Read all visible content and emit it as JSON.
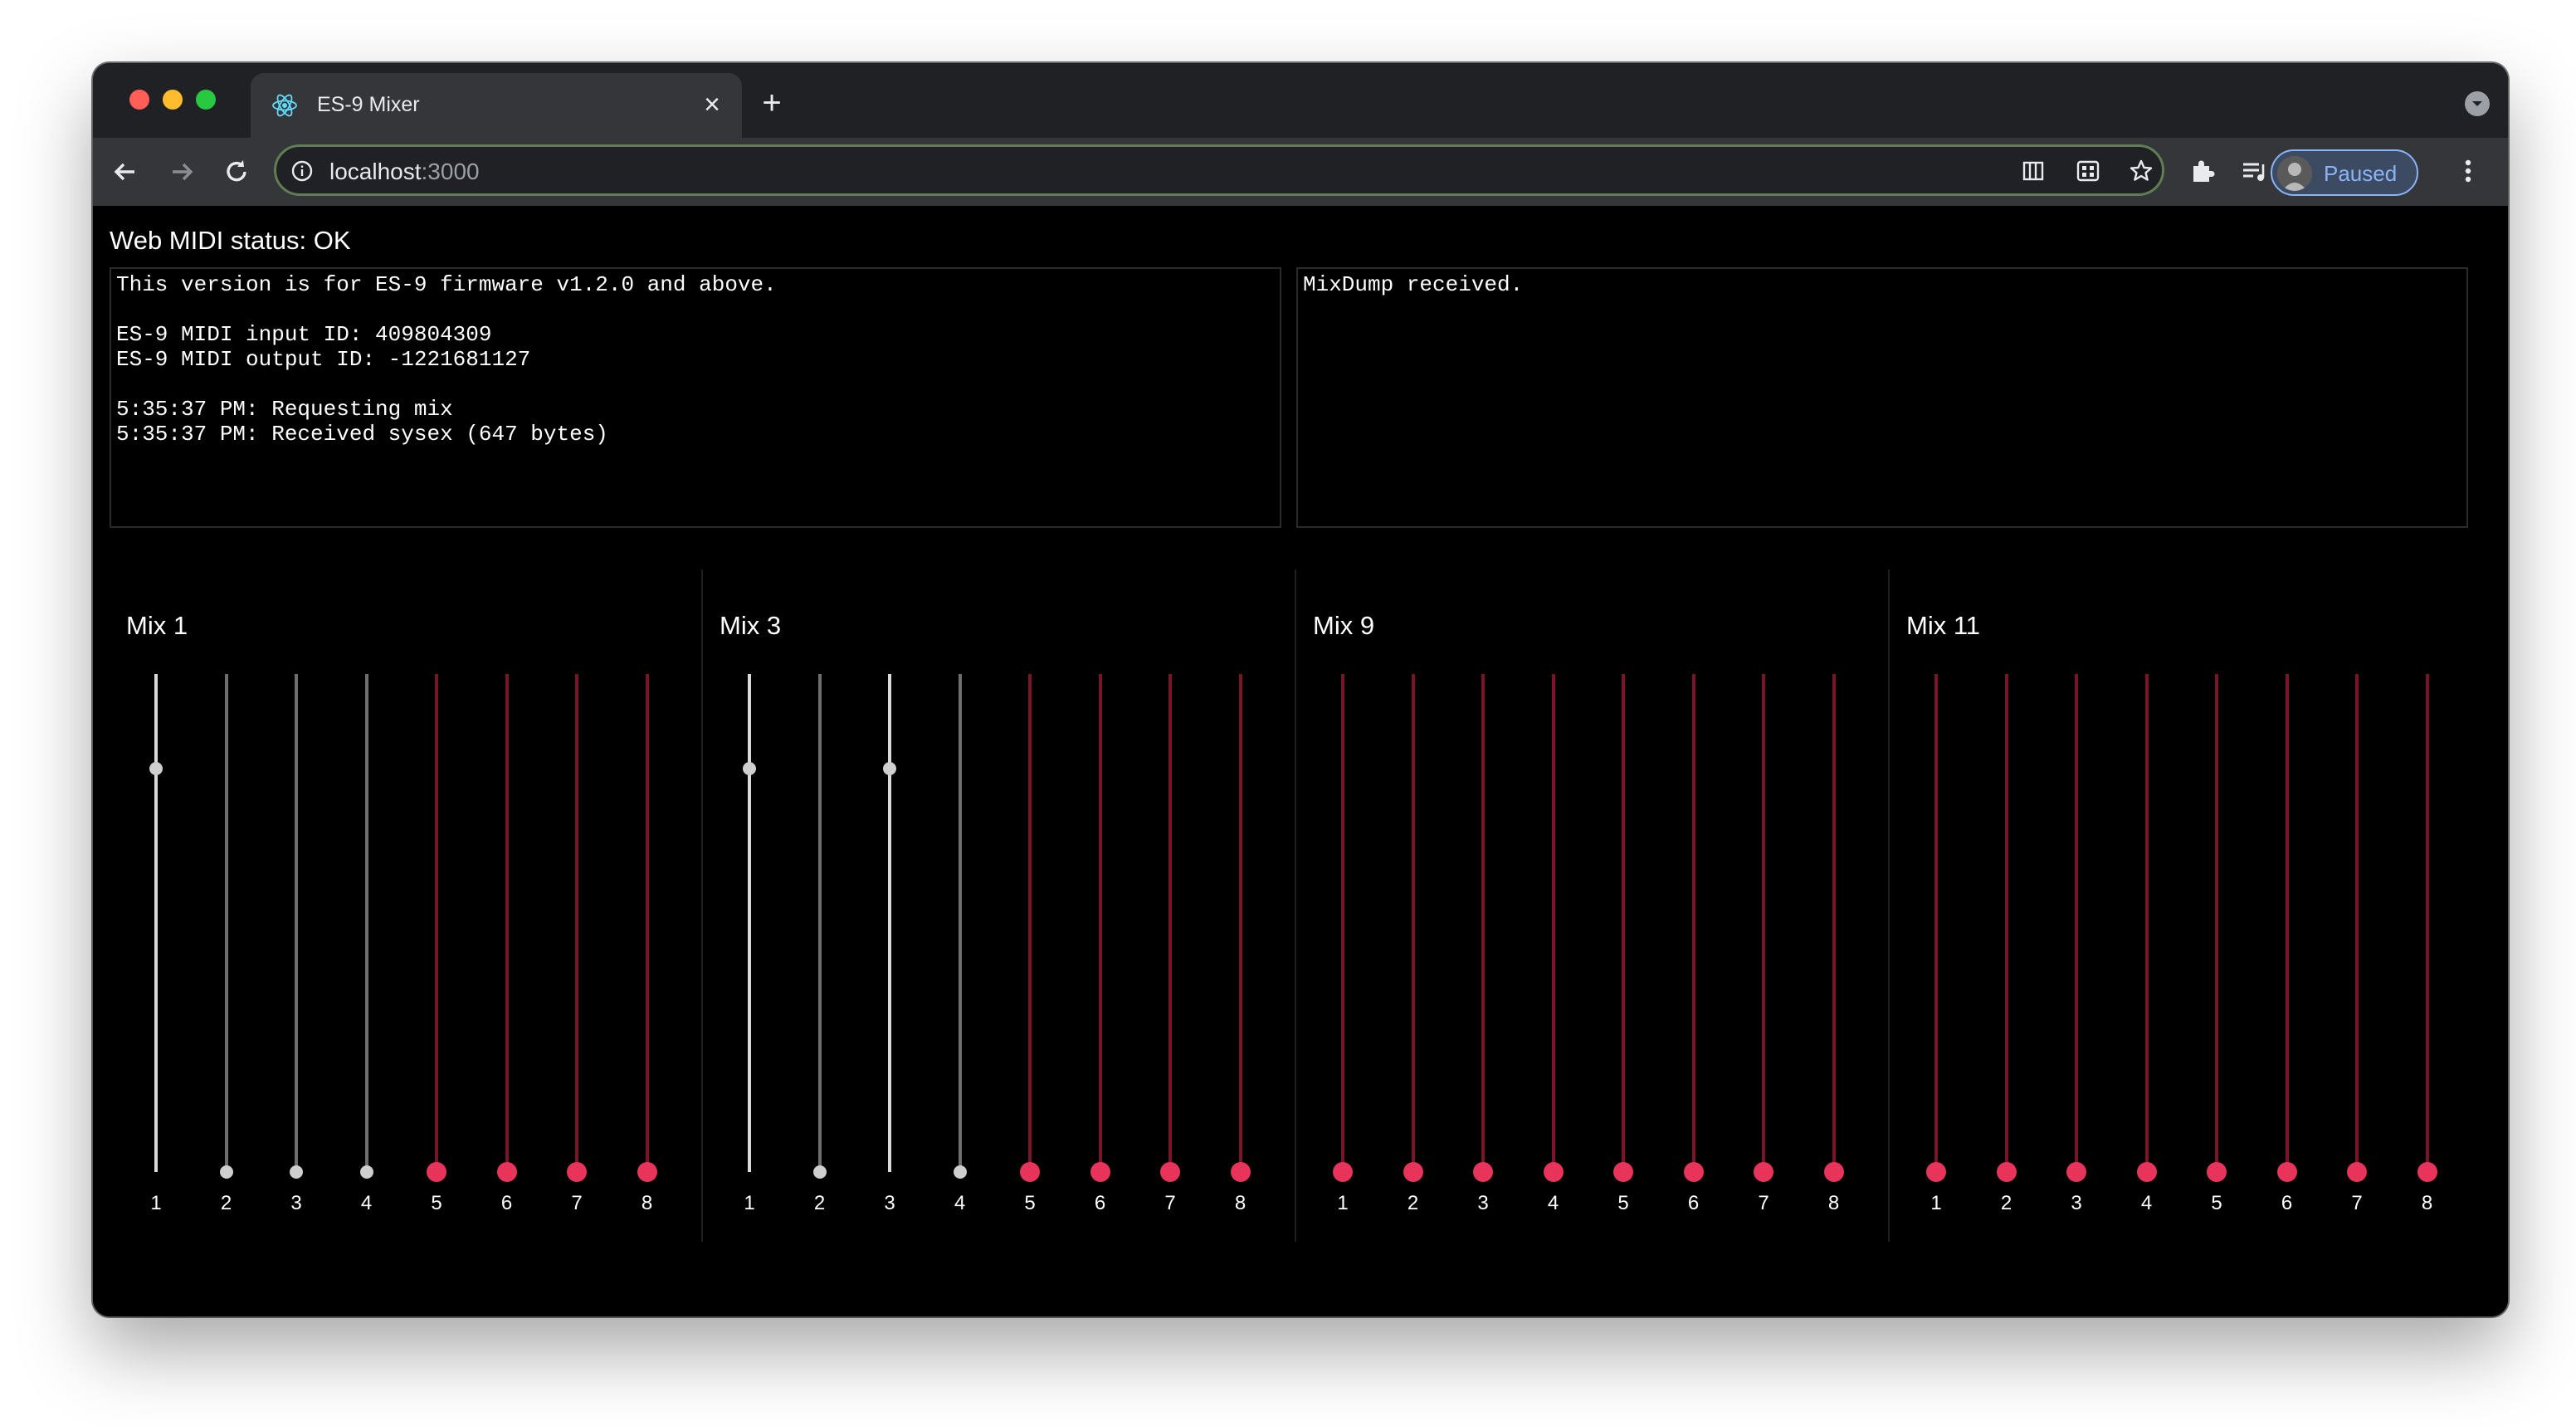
{
  "browser": {
    "tab_title": "ES-9 Mixer",
    "tab_close": "×",
    "new_tab": "+",
    "url_host": "localhost",
    "url_port": ":3000",
    "profile_label": "Paused"
  },
  "page": {
    "midi_status": "Web MIDI status: OK",
    "log_left": "This version is for ES-9 firmware v1.2.0 and above.\n\nES-9 MIDI input ID: 409804309\nES-9 MIDI output ID: -1221681127\n\n5:35:37 PM: Requesting mix\n5:35:37 PM: Received sysex (647 bytes)",
    "log_right": "MixDump received."
  },
  "colors": {
    "active_track": "#d9d9d9",
    "inactive_track": "#6e6e6e",
    "muted_track": "#7a1428",
    "muted_knob": "#e8345a",
    "knob": "#cfcfcf"
  },
  "mixes": [
    {
      "title": "Mix 1",
      "faders": [
        {
          "label": "1",
          "level": 0.81,
          "muted": false
        },
        {
          "label": "2",
          "level": 0,
          "muted": false
        },
        {
          "label": "3",
          "level": 0,
          "muted": false
        },
        {
          "label": "4",
          "level": 0,
          "muted": false
        },
        {
          "label": "5",
          "level": 0,
          "muted": true
        },
        {
          "label": "6",
          "level": 0,
          "muted": true
        },
        {
          "label": "7",
          "level": 0,
          "muted": true
        },
        {
          "label": "8",
          "level": 0,
          "muted": true
        }
      ]
    },
    {
      "title": "Mix 3",
      "faders": [
        {
          "label": "1",
          "level": 0.81,
          "muted": false
        },
        {
          "label": "2",
          "level": 0,
          "muted": false
        },
        {
          "label": "3",
          "level": 0.81,
          "muted": false
        },
        {
          "label": "4",
          "level": 0,
          "muted": false
        },
        {
          "label": "5",
          "level": 0,
          "muted": true
        },
        {
          "label": "6",
          "level": 0,
          "muted": true
        },
        {
          "label": "7",
          "level": 0,
          "muted": true
        },
        {
          "label": "8",
          "level": 0,
          "muted": true
        }
      ]
    },
    {
      "title": "Mix 9",
      "faders": [
        {
          "label": "1",
          "level": 0,
          "muted": true
        },
        {
          "label": "2",
          "level": 0,
          "muted": true
        },
        {
          "label": "3",
          "level": 0,
          "muted": true
        },
        {
          "label": "4",
          "level": 0,
          "muted": true
        },
        {
          "label": "5",
          "level": 0,
          "muted": true
        },
        {
          "label": "6",
          "level": 0,
          "muted": true
        },
        {
          "label": "7",
          "level": 0,
          "muted": true
        },
        {
          "label": "8",
          "level": 0,
          "muted": true
        }
      ]
    },
    {
      "title": "Mix 11",
      "faders": [
        {
          "label": "1",
          "level": 0,
          "muted": true
        },
        {
          "label": "2",
          "level": 0,
          "muted": true
        },
        {
          "label": "3",
          "level": 0,
          "muted": true
        },
        {
          "label": "4",
          "level": 0,
          "muted": true
        },
        {
          "label": "5",
          "level": 0,
          "muted": true
        },
        {
          "label": "6",
          "level": 0,
          "muted": true
        },
        {
          "label": "7",
          "level": 0,
          "muted": true
        },
        {
          "label": "8",
          "level": 0,
          "muted": true
        }
      ]
    }
  ]
}
